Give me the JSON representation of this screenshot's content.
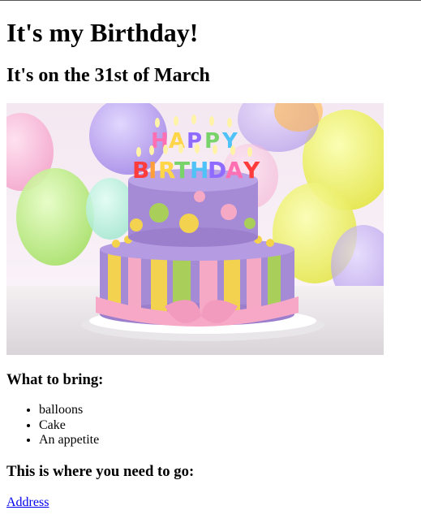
{
  "page": {
    "title": "It's my Birthday!",
    "subtitle": "It's on the 31st of March",
    "bring_heading": "What to bring:",
    "bring_items": [
      "balloons",
      "Cake",
      "An appetite"
    ],
    "destination_heading": "This is where you need to go:",
    "address_link": "Address"
  },
  "image": {
    "subject": "birthday-cake-photo",
    "cake_topper_text": "HAPPY BIRTHDAY",
    "colors": {
      "cake_purple": "#a58bd6",
      "stripe_yellow": "#f2d24e",
      "stripe_green": "#a9cf5a",
      "stripe_pink": "#f6a9c4",
      "ribbon_pink": "#f7a8c7",
      "balloon_yellow": "#f0f05a",
      "balloon_green": "#b8ec7a",
      "balloon_purple": "#b59bef"
    }
  }
}
